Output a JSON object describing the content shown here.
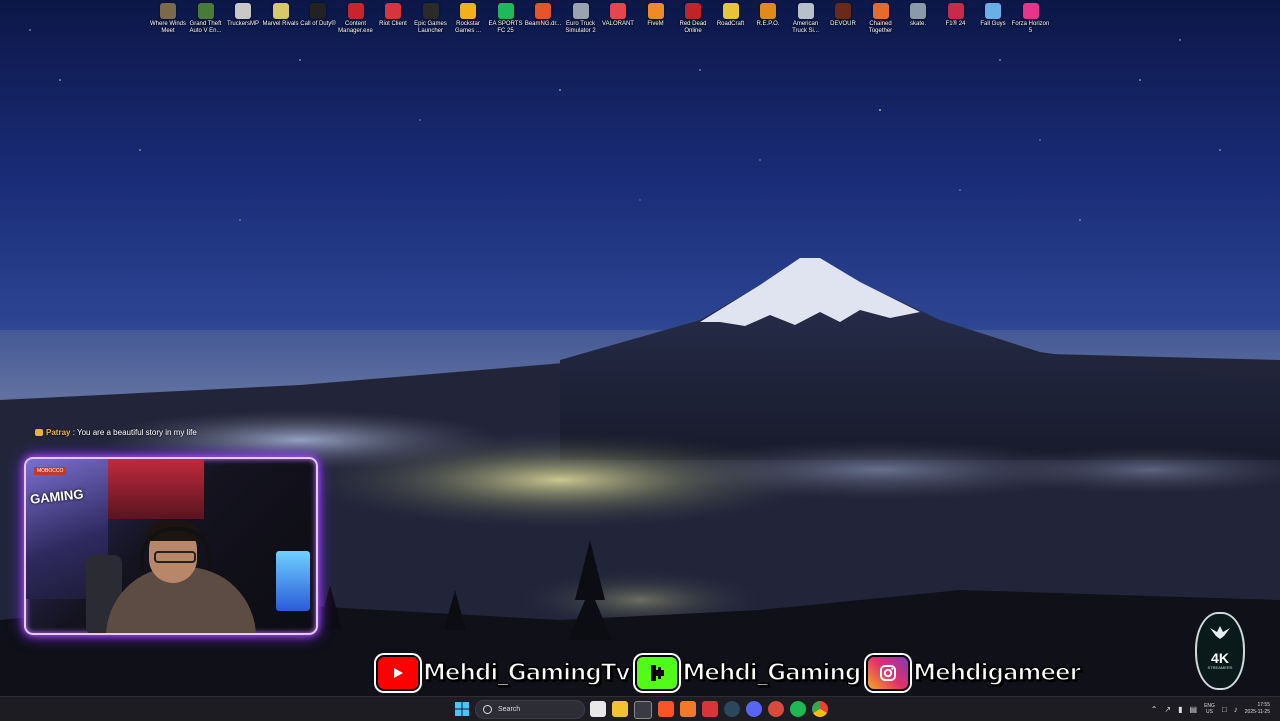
{
  "desktop_icons": [
    {
      "label": "Where Winds Meet",
      "color": "#7a6a4a",
      "icon": "wwm-icon"
    },
    {
      "label": "Grand Theft Auto V En...",
      "color": "#4a7a3a",
      "icon": "gta-icon"
    },
    {
      "label": "TruckersMP",
      "color": "#c8c8c8",
      "icon": "truck-icon"
    },
    {
      "label": "Marvel Rivals",
      "color": "#d8c86a",
      "icon": "marvel-icon"
    },
    {
      "label": "Call of Duty®",
      "color": "#222222",
      "icon": "cod-icon"
    },
    {
      "label": "Content Manager.exe",
      "color": "#c8242b",
      "icon": "cm-icon"
    },
    {
      "label": "Riot Client",
      "color": "#d8343c",
      "icon": "riot-icon"
    },
    {
      "label": "Epic Games Launcher",
      "color": "#2a2a2a",
      "icon": "epic-icon"
    },
    {
      "label": "Rockstar Games ...",
      "color": "#f2b01e",
      "icon": "rockstar-icon"
    },
    {
      "label": "EA SPORTS FC 25",
      "color": "#1fb85a",
      "icon": "fc-icon"
    },
    {
      "label": "BeamNG.dr...",
      "color": "#e8542a",
      "icon": "beamng-icon"
    },
    {
      "label": "Euro Truck Simulator 2",
      "color": "#9aa4b0",
      "icon": "ets-icon"
    },
    {
      "label": "VALORANT",
      "color": "#e6454e",
      "icon": "valorant-icon"
    },
    {
      "label": "FiveM",
      "color": "#f08a26",
      "icon": "fivem-icon"
    },
    {
      "label": "Red Dead Online",
      "color": "#c02424",
      "icon": "rdo-icon"
    },
    {
      "label": "RoadCraft",
      "color": "#e8c43a",
      "icon": "roadcraft-icon"
    },
    {
      "label": "R.E.P.O.",
      "color": "#e08a1a",
      "icon": "repo-icon"
    },
    {
      "label": "American Truck Si...",
      "color": "#b8c0cc",
      "icon": "ats-icon"
    },
    {
      "label": "DEVOUR",
      "color": "#6a2a1a",
      "icon": "devour-icon"
    },
    {
      "label": "Chained Together",
      "color": "#e86a2a",
      "icon": "chained-icon"
    },
    {
      "label": "skate.",
      "color": "#8a9aa8",
      "icon": "skate-icon"
    },
    {
      "label": "F1® 24",
      "color": "#c82a4a",
      "icon": "f1-icon"
    },
    {
      "label": "Fall Guys",
      "color": "#6ab0e8",
      "icon": "fallguys-icon"
    },
    {
      "label": "Forza Horizon 5",
      "color": "#e8348a",
      "icon": "forza-icon"
    }
  ],
  "chat": {
    "user": "Patray",
    "separator": " : ",
    "message": "You are a beautiful story in my life"
  },
  "webcam": {
    "poster_top": "MOBOCCO",
    "poster_text": "GAMING"
  },
  "socials": [
    {
      "network": "youtube",
      "icon": "youtube-icon",
      "color": "#ff0000",
      "handle": "Mehdi_GamingTv"
    },
    {
      "network": "kick",
      "icon": "kick-icon",
      "color": "#53fc18",
      "handle": "Mehdi_Gaming"
    },
    {
      "network": "instagram",
      "icon": "instagram-icon",
      "color": "#e1306c",
      "handle": "Mehdigameer"
    }
  ],
  "logo": {
    "main": "4K",
    "sub": "STREAMERS"
  },
  "taskbar": {
    "search_placeholder": "Search",
    "apps": [
      {
        "icon": "app-icon-1",
        "color": "#e8e8e8"
      },
      {
        "icon": "file-explorer-icon",
        "color": "#f2c230"
      },
      {
        "icon": "store-icon",
        "color": "#3a3a44"
      },
      {
        "icon": "brave-icon",
        "color": "#fb542b"
      },
      {
        "icon": "app-icon-a",
        "color": "#f07a2a"
      },
      {
        "icon": "app-icon-red",
        "color": "#d8343c"
      },
      {
        "icon": "steam-icon",
        "color": "#2a475e"
      },
      {
        "icon": "discord-icon",
        "color": "#5865f2"
      },
      {
        "icon": "chrome-alt-icon",
        "color": "#d84a3a"
      },
      {
        "icon": "spotify-icon",
        "color": "#1db954"
      },
      {
        "icon": "chrome-icon",
        "color": "#f4c20d"
      }
    ],
    "language_line1": "ENG",
    "language_line2": "US",
    "time": "17:55",
    "date": "2025-11-25"
  }
}
